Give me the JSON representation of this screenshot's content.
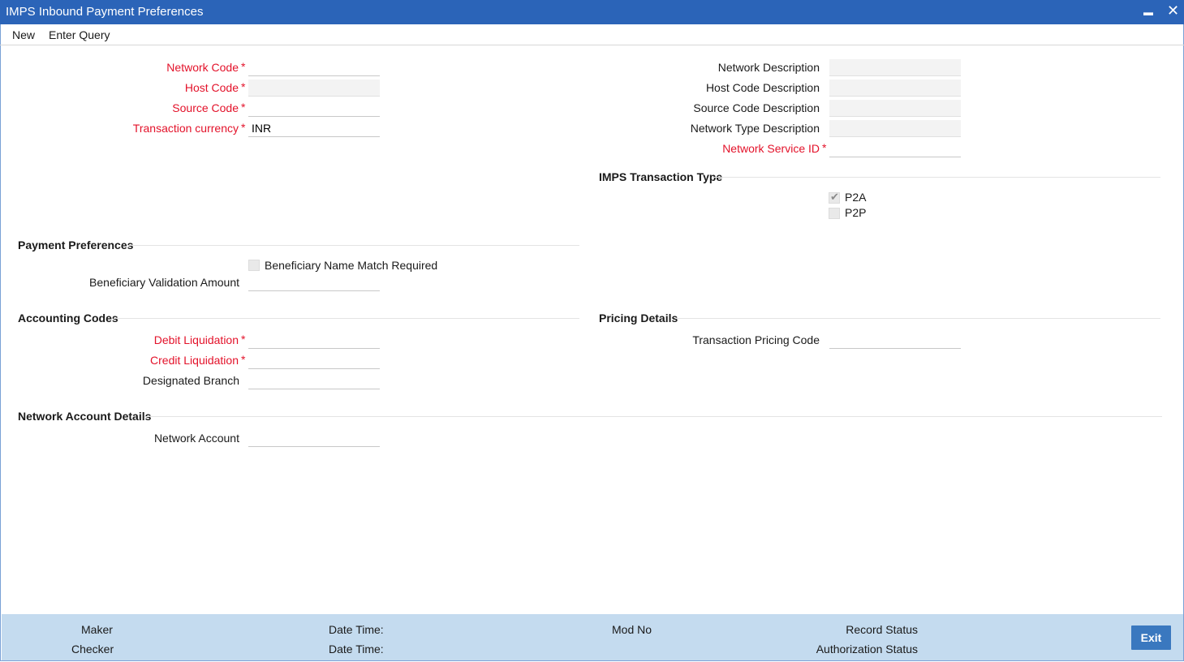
{
  "window": {
    "title": "IMPS Inbound Payment Preferences",
    "minimize_glyph": "▬",
    "close_glyph": "✕"
  },
  "menu": {
    "new": "New",
    "enter_query": "Enter Query"
  },
  "fields": {
    "network_code": {
      "label": "Network Code",
      "value": ""
    },
    "host_code": {
      "label": "Host Code",
      "value": ""
    },
    "source_code": {
      "label": "Source Code",
      "value": ""
    },
    "transaction_currency": {
      "label": "Transaction currency",
      "value": "INR"
    },
    "network_description": {
      "label": "Network Description",
      "value": ""
    },
    "host_code_description": {
      "label": "Host Code Description",
      "value": ""
    },
    "source_code_description": {
      "label": "Source Code Description",
      "value": ""
    },
    "network_type_description": {
      "label": "Network Type Description",
      "value": ""
    },
    "network_service_id": {
      "label": "Network Service ID",
      "value": ""
    }
  },
  "required_mark": "*",
  "imps_transaction_type": {
    "title": "IMPS Transaction Type",
    "p2a": {
      "label": "P2A",
      "checked": true
    },
    "p2p": {
      "label": "P2P",
      "checked": false
    }
  },
  "payment_preferences": {
    "title": "Payment Preferences",
    "beneficiary_name_match": {
      "label": "Beneficiary Name Match Required",
      "checked": false
    },
    "beneficiary_validation_amount": {
      "label": "Beneficiary Validation Amount",
      "value": ""
    }
  },
  "accounting_codes": {
    "title": "Accounting Codes",
    "debit_liquidation": {
      "label": "Debit Liquidation",
      "value": ""
    },
    "credit_liquidation": {
      "label": "Credit Liquidation",
      "value": ""
    },
    "designated_branch": {
      "label": "Designated Branch",
      "value": ""
    }
  },
  "pricing_details": {
    "title": "Pricing Details",
    "transaction_pricing_code": {
      "label": "Transaction Pricing Code",
      "value": ""
    }
  },
  "network_account_details": {
    "title": "Network Account Details",
    "network_account": {
      "label": "Network Account",
      "value": ""
    }
  },
  "footer": {
    "maker": "Maker",
    "checker": "Checker",
    "date_time": "Date Time:",
    "mod_no": "Mod No",
    "record_status": "Record Status",
    "authorization_status": "Authorization Status",
    "exit": "Exit"
  },
  "colors": {
    "title_bar": "#2b64b8",
    "required": "#e3122a",
    "footer": "#c4dbef",
    "exit_button": "#3a78bf"
  }
}
